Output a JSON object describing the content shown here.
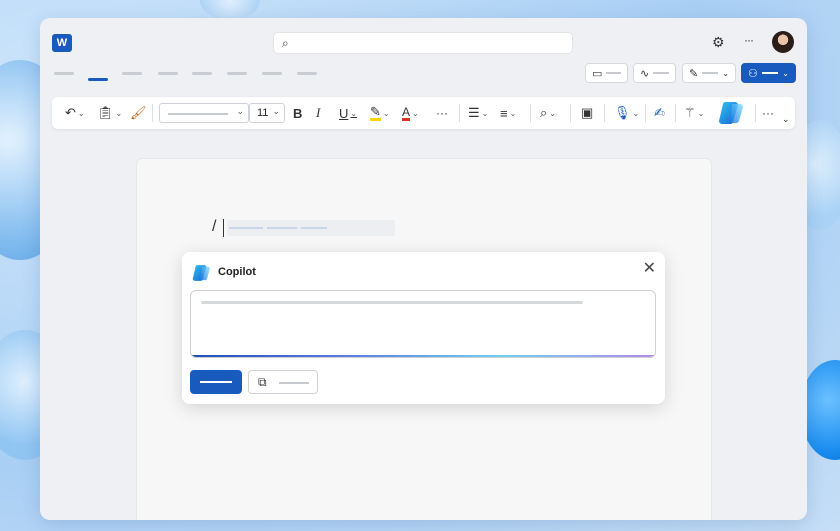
{
  "app": {
    "name": "Word",
    "logo_letter": "W"
  },
  "titlebar": {
    "search_icon": "search-icon",
    "settings_icon": "gear-icon",
    "more_label": "···"
  },
  "ribbon": {
    "font_size": "11",
    "bold": "B",
    "italic": "I",
    "underline": "U",
    "more": "···"
  },
  "document": {
    "typed_text": "/"
  },
  "copilot": {
    "title": "Copilot",
    "close": "✕"
  },
  "colors": {
    "accent": "#185abd",
    "highlight": "#ffd400",
    "font_color": "#e0301e"
  }
}
